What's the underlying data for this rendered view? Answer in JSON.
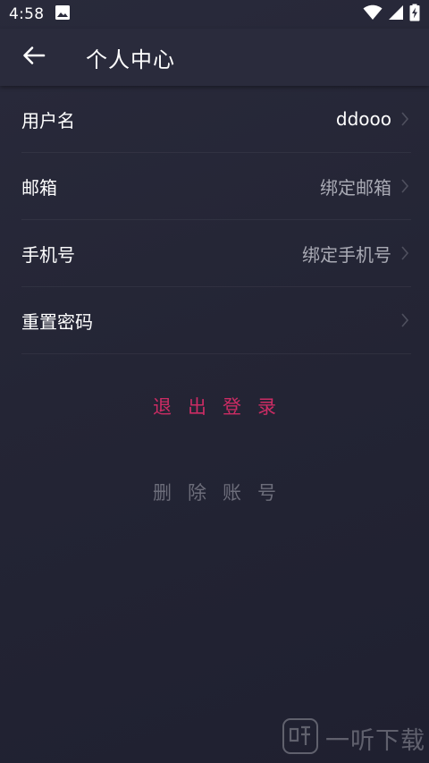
{
  "status_bar": {
    "time": "4:58",
    "icons": [
      "image-icon",
      "wifi-icon",
      "signal-icon",
      "battery-charging-icon"
    ]
  },
  "header": {
    "title": "个人中心",
    "back_icon": "arrow-left-icon"
  },
  "profile_items": [
    {
      "label": "用户名",
      "value": "ddooo"
    },
    {
      "label": "邮箱",
      "value": "绑定邮箱"
    },
    {
      "label": "手机号",
      "value": "绑定手机号"
    },
    {
      "label": "重置密码",
      "value": ""
    }
  ],
  "actions": {
    "logout_label": "退出登录",
    "delete_label": "删除账号"
  },
  "watermark": {
    "text": "一听下载"
  },
  "colors": {
    "background": "#242535",
    "accent": "#cc2c64",
    "muted": "#6c6d7a",
    "value_text": "#a9aab4"
  }
}
